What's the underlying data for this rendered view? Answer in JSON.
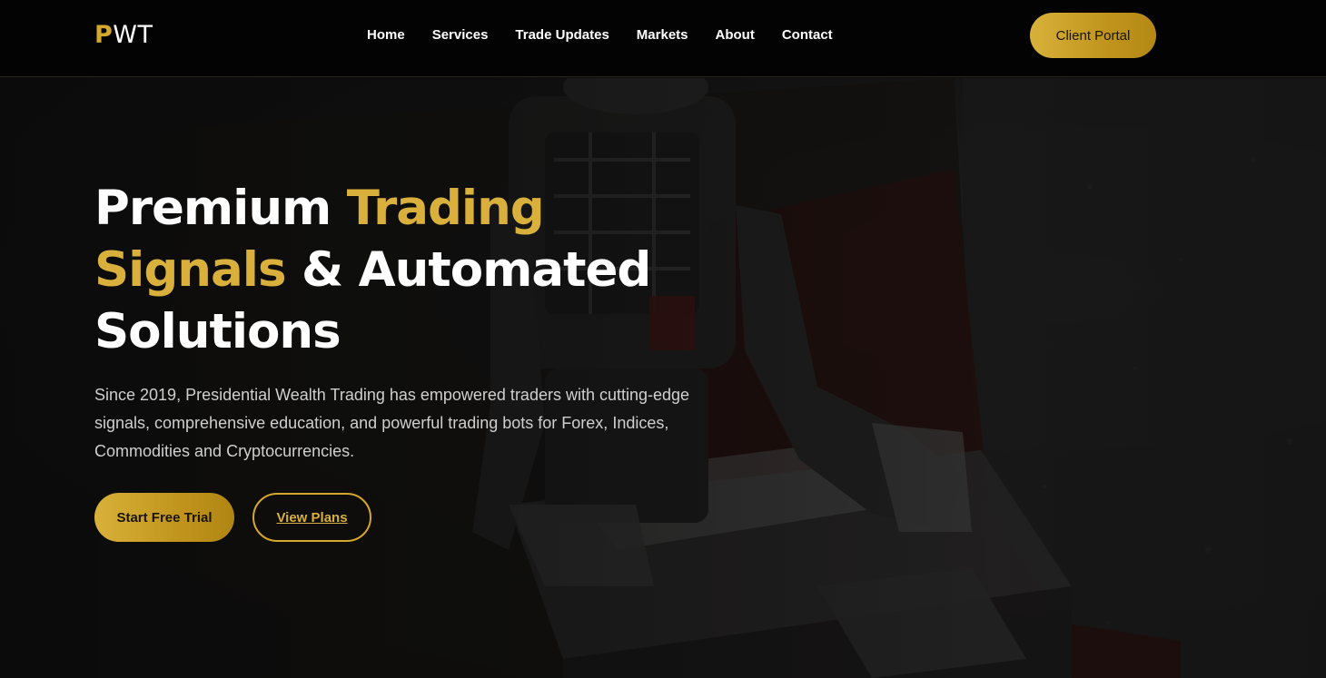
{
  "header": {
    "logo_initial": "P",
    "logo_rest": "WT",
    "nav": [
      {
        "label": "Home"
      },
      {
        "label": "Services"
      },
      {
        "label": "Trade Updates"
      },
      {
        "label": "Markets"
      },
      {
        "label": "About"
      },
      {
        "label": "Contact"
      }
    ],
    "portal_label": "Client Portal"
  },
  "hero": {
    "title_part1": "Premium ",
    "title_accent1": "Trading Signals",
    "title_part2": " & Automated Solutions",
    "description": "Since 2019, Presidential Wealth Trading has empowered traders with cutting-edge signals, comprehensive education, and powerful trading bots for Forex, Indices, Commodities and Cryptocurrencies.",
    "primary_cta": "Start Free Trial",
    "secondary_cta": "View Plans",
    "background_image": "robot-at-desk-photo"
  },
  "colors": {
    "accent_gold": "#d4a82c",
    "header_bg": "#030303",
    "text_white": "#ffffff",
    "text_muted": "#cfcfcf"
  }
}
